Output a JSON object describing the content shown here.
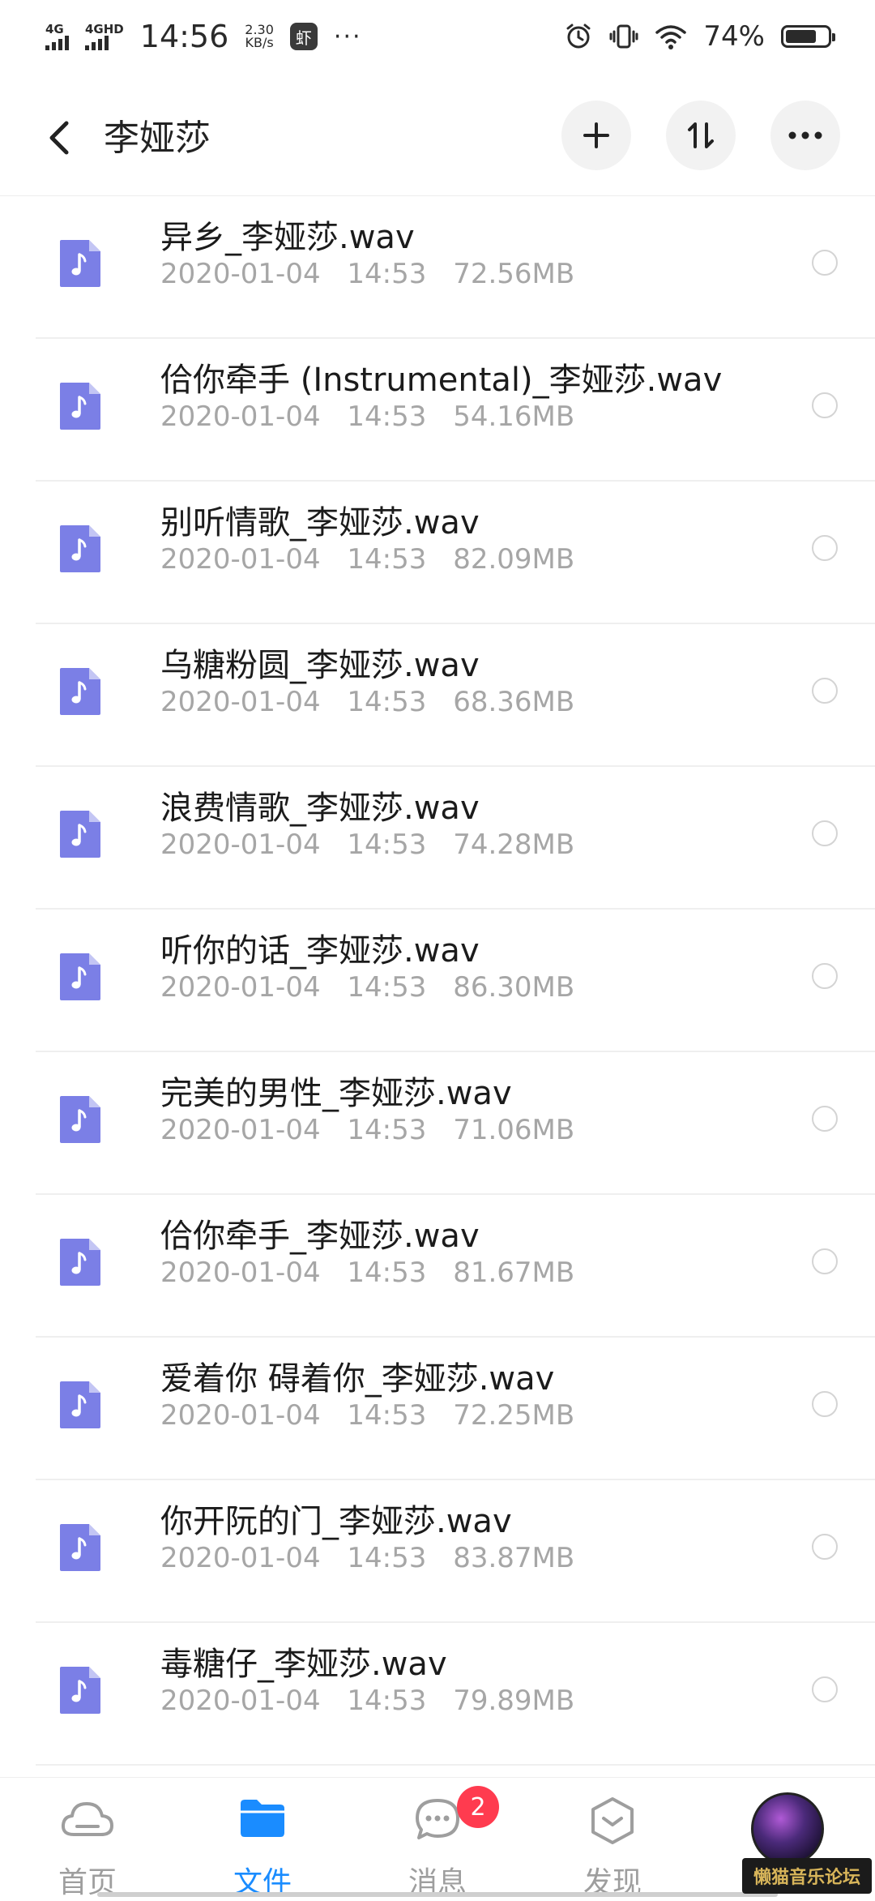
{
  "status_bar": {
    "signal1": "4G",
    "signal2": "4GHD",
    "time": "14:56",
    "speed_value": "2.30",
    "speed_unit": "KB/s",
    "app_icon_text": "虾",
    "more_dots": "···",
    "battery_pct": "74%",
    "battery_level": 0.74
  },
  "header": {
    "title": "李娅莎"
  },
  "files": [
    {
      "name": "异乡_李娅莎.wav",
      "date": "2020-01-04",
      "time": "14:53",
      "size": "72.56MB"
    },
    {
      "name": "佮你牵手 (Instrumental)_李娅莎.wav",
      "date": "2020-01-04",
      "time": "14:53",
      "size": "54.16MB"
    },
    {
      "name": "别听情歌_李娅莎.wav",
      "date": "2020-01-04",
      "time": "14:53",
      "size": "82.09MB"
    },
    {
      "name": "乌糖粉圆_李娅莎.wav",
      "date": "2020-01-04",
      "time": "14:53",
      "size": "68.36MB"
    },
    {
      "name": "浪费情歌_李娅莎.wav",
      "date": "2020-01-04",
      "time": "14:53",
      "size": "74.28MB"
    },
    {
      "name": "听你的话_李娅莎.wav",
      "date": "2020-01-04",
      "time": "14:53",
      "size": "86.30MB"
    },
    {
      "name": "完美的男性_李娅莎.wav",
      "date": "2020-01-04",
      "time": "14:53",
      "size": "71.06MB"
    },
    {
      "name": "佮你牵手_李娅莎.wav",
      "date": "2020-01-04",
      "time": "14:53",
      "size": "81.67MB"
    },
    {
      "name": "爱着你 碍着你_李娅莎.wav",
      "date": "2020-01-04",
      "time": "14:53",
      "size": "72.25MB"
    },
    {
      "name": "你开阮的门_李娅莎.wav",
      "date": "2020-01-04",
      "time": "14:53",
      "size": "83.87MB"
    },
    {
      "name": "毒糖仔_李娅莎.wav",
      "date": "2020-01-04",
      "time": "14:53",
      "size": "79.89MB"
    }
  ],
  "bottom_nav": {
    "home": "首页",
    "files": "文件",
    "messages": "消息",
    "messages_badge": "2",
    "discover": "发现"
  },
  "watermark": "懒猫音乐论坛",
  "colors": {
    "accent": "#1a8cff",
    "file_icon": "#7b7fe6",
    "badge": "#ff3b4f",
    "meta_text": "#a6a6a6"
  }
}
